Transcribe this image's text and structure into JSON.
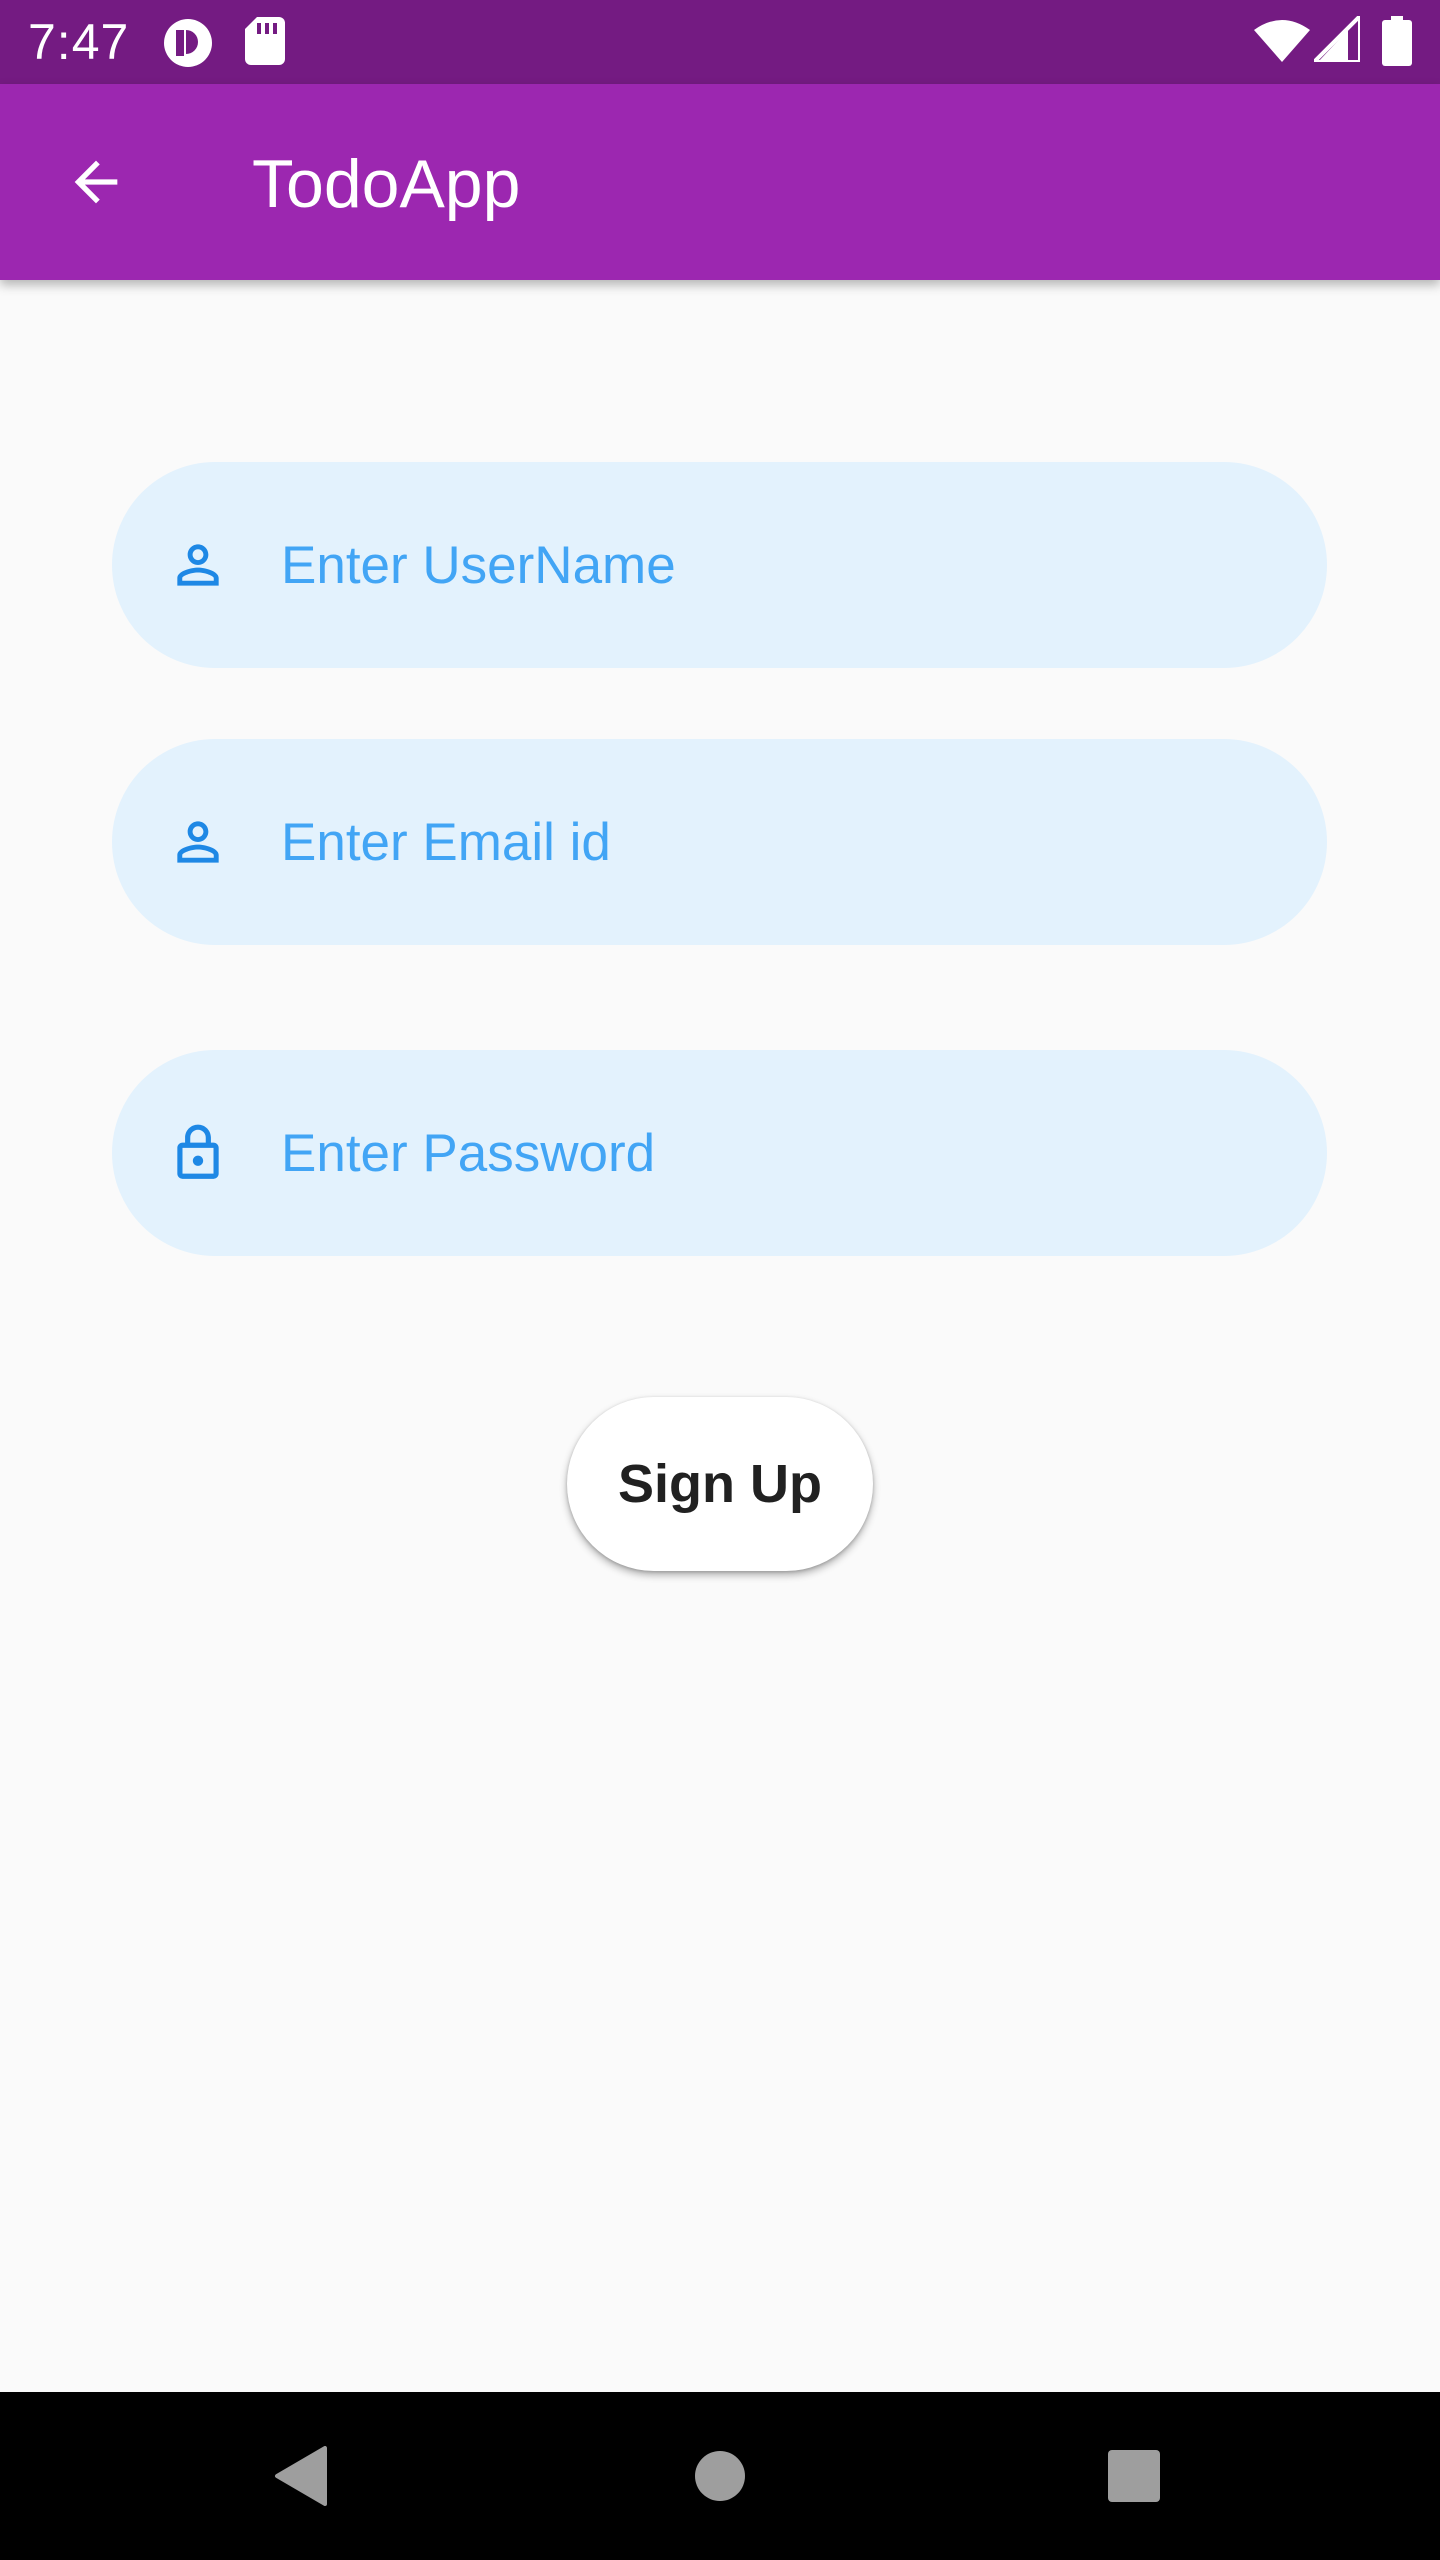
{
  "status_bar": {
    "time": "7:47",
    "icons": [
      "notification-app-icon",
      "sd-card-icon",
      "wifi-icon",
      "cell-signal-icon",
      "battery-icon"
    ]
  },
  "app_bar": {
    "title": "TodoApp",
    "back_icon": "arrow-back-icon"
  },
  "form": {
    "username": {
      "placeholder": "Enter UserName",
      "value": "",
      "icon": "person-icon"
    },
    "email": {
      "placeholder": "Enter Email id",
      "value": "",
      "icon": "person-icon"
    },
    "password": {
      "placeholder": "Enter Password",
      "value": "",
      "icon": "lock-icon"
    },
    "submit_label": "Sign Up"
  },
  "nav_bar": {
    "buttons": [
      "back-triangle-icon",
      "home-circle-icon",
      "recents-square-icon"
    ]
  },
  "colors": {
    "status_bar": "#741b82",
    "app_bar": "#9c27b0",
    "field_background": "#e3f2fd",
    "field_icon": "#1e88e5",
    "placeholder": "#42a5f5",
    "page_background": "#fafafa",
    "nav_bar": "#000000"
  }
}
